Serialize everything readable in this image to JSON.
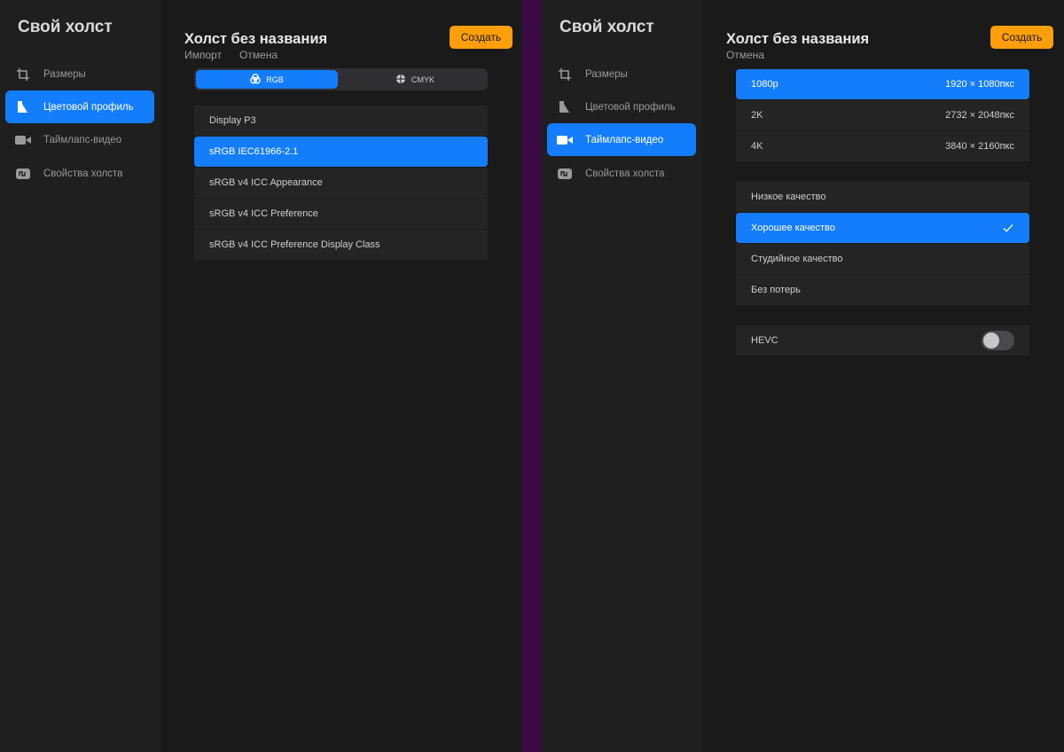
{
  "left": {
    "sidebar": {
      "title": "Свой холст",
      "items": [
        {
          "label": "Размеры",
          "icon": "crop-icon"
        },
        {
          "label": "Цветовой профиль",
          "icon": "color-profile-icon"
        },
        {
          "label": "Таймлапс-видео",
          "icon": "video-camera-icon"
        },
        {
          "label": "Свойства холста",
          "icon": "canvas-properties-icon"
        }
      ],
      "active_index": 1
    },
    "main": {
      "title": "Холст без названия",
      "import_label": "Импорт",
      "cancel_label": "Отмена",
      "create_label": "Создать",
      "segment": {
        "rgb": "RGB",
        "cmyk": "CMYK",
        "selected": "RGB"
      },
      "profiles": [
        "Display P3",
        "sRGB IEC61966-2.1",
        "sRGB v4 ICC Appearance",
        "sRGB v4 ICC Preference",
        "sRGB v4 ICC Preference Display Class"
      ],
      "selected_profile_index": 1
    }
  },
  "right": {
    "sidebar": {
      "title": "Свой холст",
      "items": [
        {
          "label": "Размеры",
          "icon": "crop-icon"
        },
        {
          "label": "Цветовой профиль",
          "icon": "color-profile-icon"
        },
        {
          "label": "Таймлапс-видео",
          "icon": "video-camera-icon"
        },
        {
          "label": "Свойства холста",
          "icon": "canvas-properties-icon"
        }
      ],
      "active_index": 2
    },
    "main": {
      "title": "Холст без названия",
      "cancel_label": "Отмена",
      "create_label": "Создать",
      "resolutions": [
        {
          "name": "1080p",
          "size": "1920 × 1080пкс"
        },
        {
          "name": "2K",
          "size": "2732 × 2048пкс"
        },
        {
          "name": "4K",
          "size": "3840 × 2160пкс"
        }
      ],
      "selected_resolution_index": 0,
      "qualities": [
        "Низкое качество",
        "Хорошее качество",
        "Студийное качество",
        "Без потерь"
      ],
      "selected_quality_index": 1,
      "hevc_label": "HEVC",
      "hevc_enabled": false
    }
  },
  "colors": {
    "accent": "#147dfb",
    "create_button": "#fd9e0a",
    "divider": "#3a0a44"
  }
}
